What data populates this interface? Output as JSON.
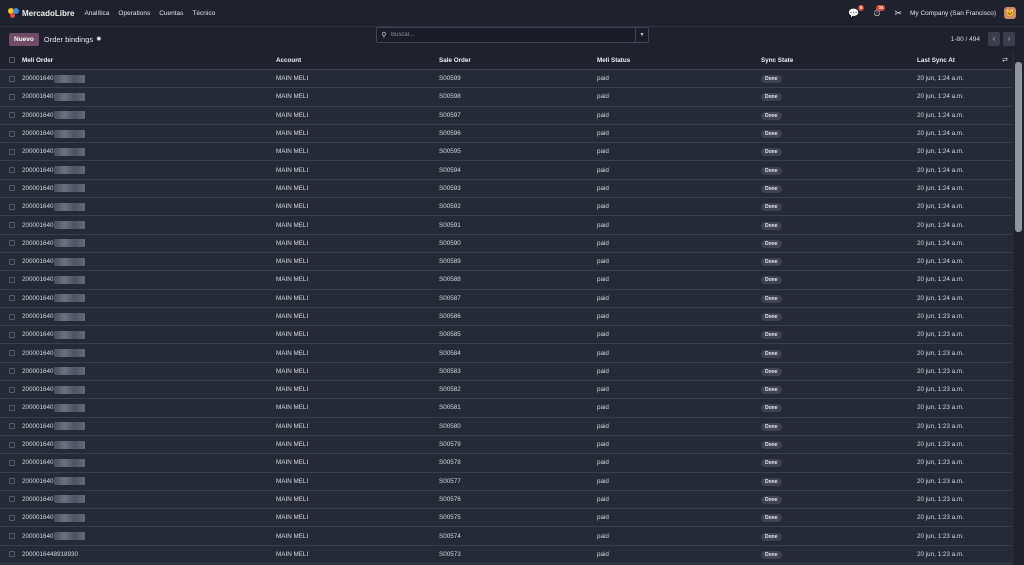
{
  "app": {
    "brand": "MercadoLibre",
    "menu": [
      "Analítica",
      "Operations",
      "Cuentas",
      "Técnico"
    ]
  },
  "systray": {
    "messages_badge": "8",
    "activity_badge": "34",
    "company": "My Company (San Francisco)"
  },
  "control": {
    "new_label": "Nuevo",
    "title": "Order bindings",
    "search_placeholder": "Buscar...",
    "pager": "1-80 / 494"
  },
  "columns": [
    "Meli Order",
    "Account",
    "Sale Order",
    "Meli Status",
    "Sync State",
    "Last Sync At"
  ],
  "rows": [
    {
      "order": "200001640",
      "account": "MAIN MELI",
      "sale": "S00599",
      "status": "paid",
      "sync": "Done",
      "last": "20 jun, 1:24 a.m."
    },
    {
      "order": "200001640",
      "account": "MAIN MELI",
      "sale": "S00598",
      "status": "paid",
      "sync": "Done",
      "last": "20 jun, 1:24 a.m."
    },
    {
      "order": "200001640",
      "account": "MAIN MELI",
      "sale": "S00597",
      "status": "paid",
      "sync": "Done",
      "last": "20 jun, 1:24 a.m."
    },
    {
      "order": "200001640",
      "account": "MAIN MELI",
      "sale": "S00596",
      "status": "paid",
      "sync": "Done",
      "last": "20 jun, 1:24 a.m."
    },
    {
      "order": "200001640",
      "account": "MAIN MELI",
      "sale": "S00595",
      "status": "paid",
      "sync": "Done",
      "last": "20 jun, 1:24 a.m."
    },
    {
      "order": "200001640",
      "account": "MAIN MELI",
      "sale": "S00594",
      "status": "paid",
      "sync": "Done",
      "last": "20 jun, 1:24 a.m."
    },
    {
      "order": "200001640",
      "account": "MAIN MELI",
      "sale": "S00593",
      "status": "paid",
      "sync": "Done",
      "last": "20 jun, 1:24 a.m."
    },
    {
      "order": "200001640",
      "account": "MAIN MELI",
      "sale": "S00592",
      "status": "paid",
      "sync": "Done",
      "last": "20 jun, 1:24 a.m."
    },
    {
      "order": "200001640",
      "account": "MAIN MELI",
      "sale": "S00591",
      "status": "paid",
      "sync": "Done",
      "last": "20 jun, 1:24 a.m."
    },
    {
      "order": "200001640",
      "account": "MAIN MELI",
      "sale": "S00590",
      "status": "paid",
      "sync": "Done",
      "last": "20 jun, 1:24 a.m."
    },
    {
      "order": "200001640",
      "account": "MAIN MELI",
      "sale": "S00589",
      "status": "paid",
      "sync": "Done",
      "last": "20 jun, 1:24 a.m."
    },
    {
      "order": "200001640",
      "account": "MAIN MELI",
      "sale": "S00588",
      "status": "paid",
      "sync": "Done",
      "last": "20 jun, 1:24 a.m."
    },
    {
      "order": "200001640",
      "account": "MAIN MELI",
      "sale": "S00587",
      "status": "paid",
      "sync": "Done",
      "last": "20 jun, 1:24 a.m."
    },
    {
      "order": "200001640",
      "account": "MAIN MELI",
      "sale": "S00586",
      "status": "paid",
      "sync": "Done",
      "last": "20 jun, 1:23 a.m."
    },
    {
      "order": "200001640",
      "account": "MAIN MELI",
      "sale": "S00585",
      "status": "paid",
      "sync": "Done",
      "last": "20 jun, 1:23 a.m."
    },
    {
      "order": "200001640",
      "account": "MAIN MELI",
      "sale": "S00584",
      "status": "paid",
      "sync": "Done",
      "last": "20 jun, 1:23 a.m."
    },
    {
      "order": "200001640",
      "account": "MAIN MELI",
      "sale": "S00583",
      "status": "paid",
      "sync": "Done",
      "last": "20 jun, 1:23 a.m."
    },
    {
      "order": "200001640",
      "account": "MAIN MELI",
      "sale": "S00582",
      "status": "paid",
      "sync": "Done",
      "last": "20 jun, 1:23 a.m."
    },
    {
      "order": "200001640",
      "account": "MAIN MELI",
      "sale": "S00581",
      "status": "paid",
      "sync": "Done",
      "last": "20 jun, 1:23 a.m."
    },
    {
      "order": "200001640",
      "account": "MAIN MELI",
      "sale": "S00580",
      "status": "paid",
      "sync": "Done",
      "last": "20 jun, 1:23 a.m."
    },
    {
      "order": "200001640",
      "account": "MAIN MELI",
      "sale": "S00579",
      "status": "paid",
      "sync": "Done",
      "last": "20 jun, 1:23 a.m."
    },
    {
      "order": "200001640",
      "account": "MAIN MELI",
      "sale": "S00578",
      "status": "paid",
      "sync": "Done",
      "last": "20 jun, 1:23 a.m."
    },
    {
      "order": "200001640",
      "account": "MAIN MELI",
      "sale": "S00577",
      "status": "paid",
      "sync": "Done",
      "last": "20 jun, 1:23 a.m."
    },
    {
      "order": "200001640",
      "account": "MAIN MELI",
      "sale": "S00576",
      "status": "paid",
      "sync": "Done",
      "last": "20 jun, 1:23 a.m."
    },
    {
      "order": "200001640",
      "account": "MAIN MELI",
      "sale": "S00575",
      "status": "paid",
      "sync": "Done",
      "last": "20 jun, 1:23 a.m."
    },
    {
      "order": "200001640",
      "account": "MAIN MELI",
      "sale": "S00574",
      "status": "paid",
      "sync": "Done",
      "last": "20 jun, 1:23 a.m."
    },
    {
      "order": "2000016448918930",
      "account": "MAIN MELI",
      "sale": "S00573",
      "status": "paid",
      "sync": "Done",
      "last": "20 jun, 1:23 a.m."
    }
  ],
  "colors": {
    "accent": "#714b67",
    "background": "#262a36",
    "navbar": "#1f222c",
    "badge": "#d9473c"
  }
}
